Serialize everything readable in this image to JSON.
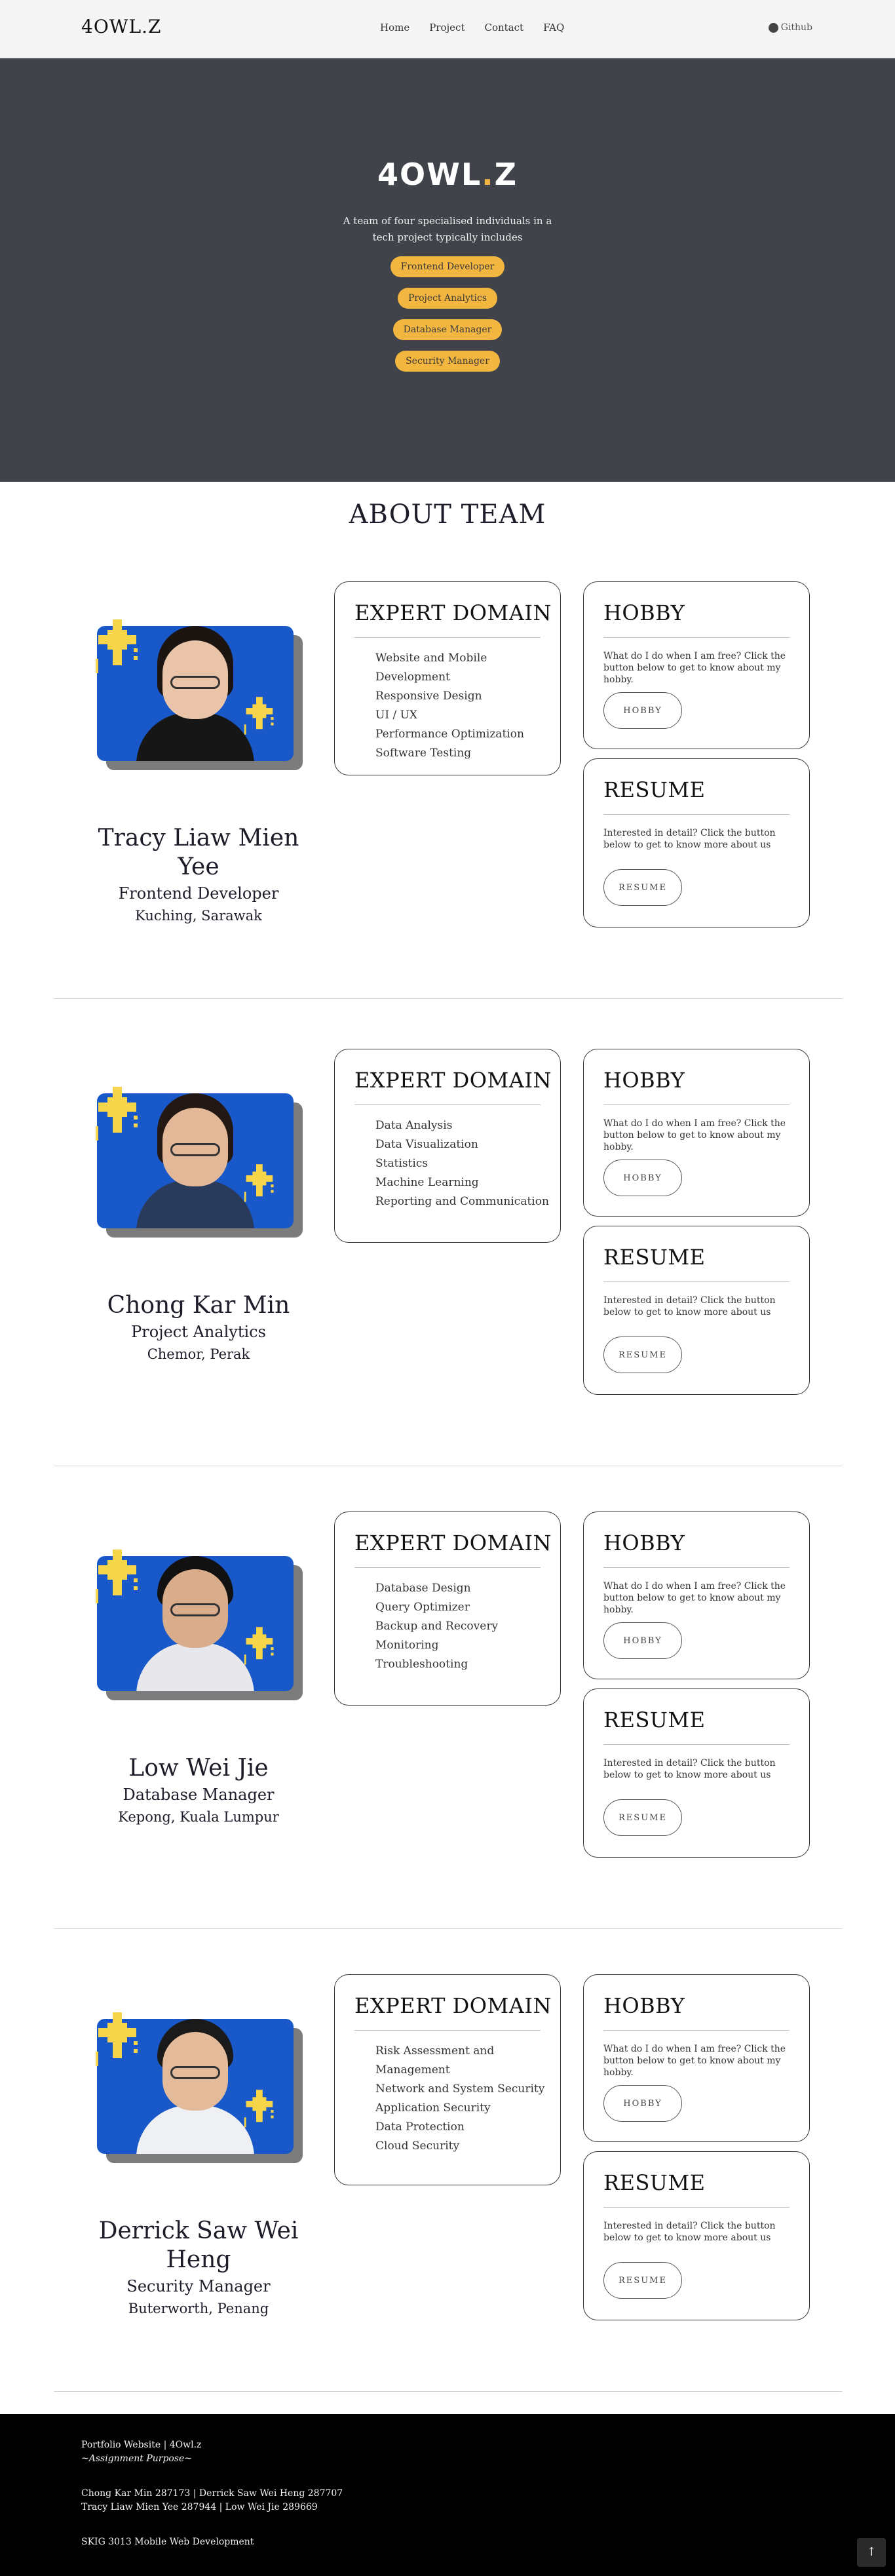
{
  "nav": {
    "brand": "4OWL.Z",
    "links": [
      "Home",
      "Project",
      "Contact",
      "FAQ"
    ],
    "github": "Github"
  },
  "hero": {
    "logo_main": "4OWL",
    "logo_dot": ".",
    "logo_end": "Z",
    "description": "A team of four specialised individuals in a tech project typically includes",
    "roles": [
      "Frontend Developer",
      "Project Analytics",
      "Database Manager",
      "Security Manager"
    ]
  },
  "about": {
    "title": "ABOUT TEAM"
  },
  "labels": {
    "expert": "EXPERT DOMAIN",
    "hobby": "HOBBY",
    "hobby_text": "What do I do when I am free? Click the button below to get to know about my hobby.",
    "hobby_btn": "HOBBY",
    "resume": "RESUME",
    "resume_text": "Interested in detail? Click the button below to get to know more about us",
    "resume_btn": "RESUME"
  },
  "members": [
    {
      "name": "Tracy Liaw Mien Yee",
      "role": "Frontend Developer",
      "location": "Kuching, Sarawak",
      "domains": [
        "Website and Mobile Development",
        "Responsive Design",
        "UI / UX",
        "Performance Optimization",
        "Software Testing"
      ]
    },
    {
      "name": "Chong Kar Min",
      "role": "Project Analytics",
      "location": "Chemor, Perak",
      "domains": [
        "Data Analysis",
        "Data Visualization",
        "Statistics",
        "Machine Learning",
        "Reporting and Communication"
      ]
    },
    {
      "name": "Low Wei Jie",
      "role": "Database Manager",
      "location": "Kepong, Kuala Lumpur",
      "domains": [
        "Database Design",
        "Query Optimizer",
        "Backup and Recovery",
        "Monitoring",
        "Troubleshooting"
      ]
    },
    {
      "name": "Derrick Saw Wei Heng",
      "role": "Security Manager",
      "location": "Buterworth, Penang",
      "domains": [
        "Risk Assessment and",
        "Management",
        "Network and System Security",
        "Application Security",
        "Data Protection",
        "Cloud Security"
      ]
    }
  ],
  "footer": {
    "line1": "Portfolio Website | 4Owl.z",
    "line2": "~Assignment Purpose~",
    "line3": "Chong Kar Min 287173 | Derrick Saw Wei Heng 287707",
    "line4": "Tracy Liaw Mien Yee 287944 | Low Wei Jie 289669",
    "line5": "SKIG 3013 Mobile Web Development",
    "top_icon": "arrow-up-icon"
  },
  "colors": {
    "hero_bg": "#40434a",
    "accent": "#f3b640",
    "photo_bg": "#1858c8",
    "footer_bg": "#000000"
  }
}
